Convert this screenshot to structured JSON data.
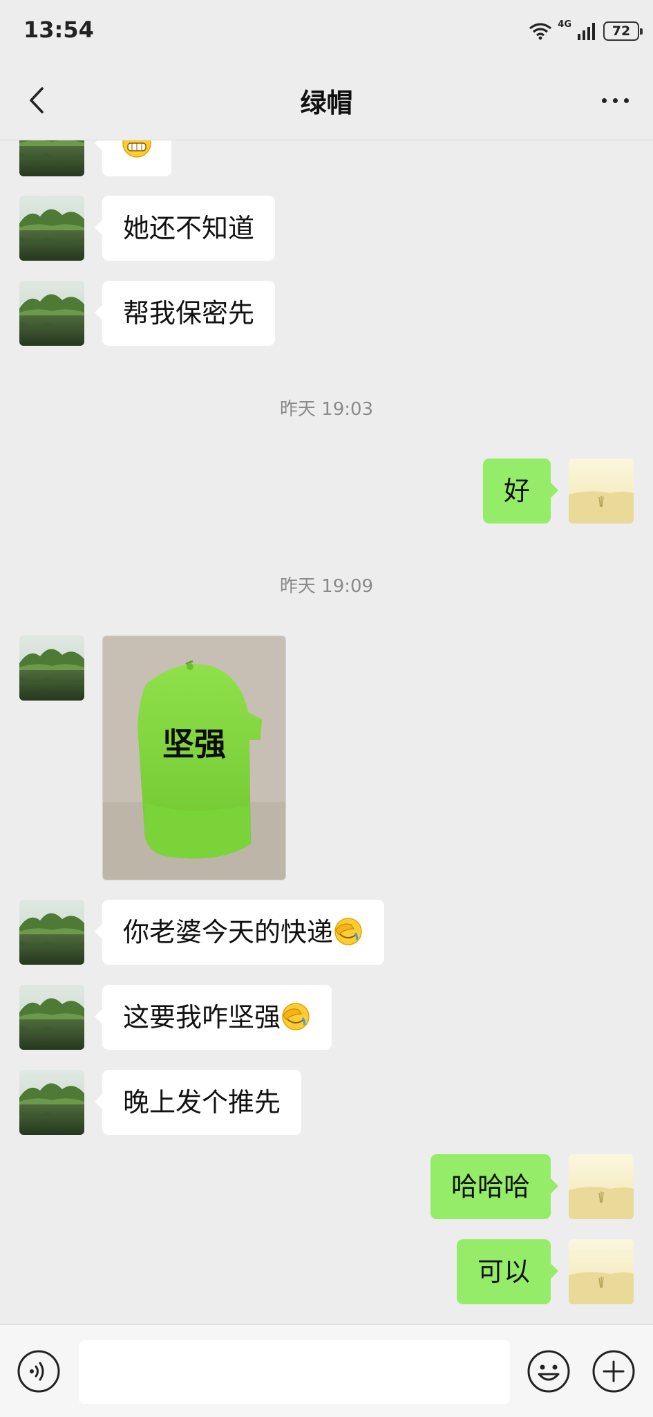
{
  "status_bar": {
    "time": "13:54",
    "network": "4G",
    "battery": "72"
  },
  "header": {
    "title": "绿帽"
  },
  "messages": [
    {
      "from": "contact",
      "text": "她还不知道"
    },
    {
      "from": "contact",
      "text": "帮我保密先"
    },
    {
      "from": "me",
      "text": "好"
    },
    {
      "from": "contact",
      "text": "你老婆今天的快递"
    },
    {
      "from": "contact",
      "text": "这要我咋坚强"
    },
    {
      "from": "contact",
      "text": "晚上发个推先"
    },
    {
      "from": "me",
      "text": "哈哈哈"
    },
    {
      "from": "me",
      "text": "可以"
    }
  ],
  "timestamps": [
    "昨天 19:03",
    "昨天 19:09"
  ],
  "image_message": {
    "caption_on_cap": "坚强"
  },
  "icons": {
    "back": "chevron-left-icon",
    "more": "more-dots-icon",
    "voice": "voice-icon",
    "emoji": "emoji-icon",
    "add": "plus-icon",
    "grin": "grin-emoji",
    "facepalm": "facepalm-emoji"
  },
  "colors": {
    "background": "#ededed",
    "my_bubble": "#95ec69",
    "their_bubble": "#ffffff"
  }
}
